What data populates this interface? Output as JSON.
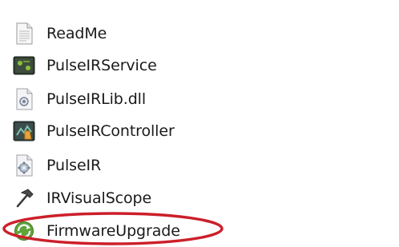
{
  "files": [
    {
      "name": "ReadMe",
      "icon": "text-document-icon"
    },
    {
      "name": "PulseIRService",
      "icon": "service-application-icon"
    },
    {
      "name": "PulseIRLib.dll",
      "icon": "dll-library-icon"
    },
    {
      "name": "PulseIRController",
      "icon": "controller-application-icon"
    },
    {
      "name": "PulseIR",
      "icon": "gear-config-icon"
    },
    {
      "name": "IRVisualScope",
      "icon": "hammer-tool-icon"
    },
    {
      "name": "FirmwareUpgrade",
      "icon": "firmware-upgrade-icon"
    }
  ],
  "highlight": {
    "target": "FirmwareUpgrade",
    "color": "#cc1f2a"
  }
}
